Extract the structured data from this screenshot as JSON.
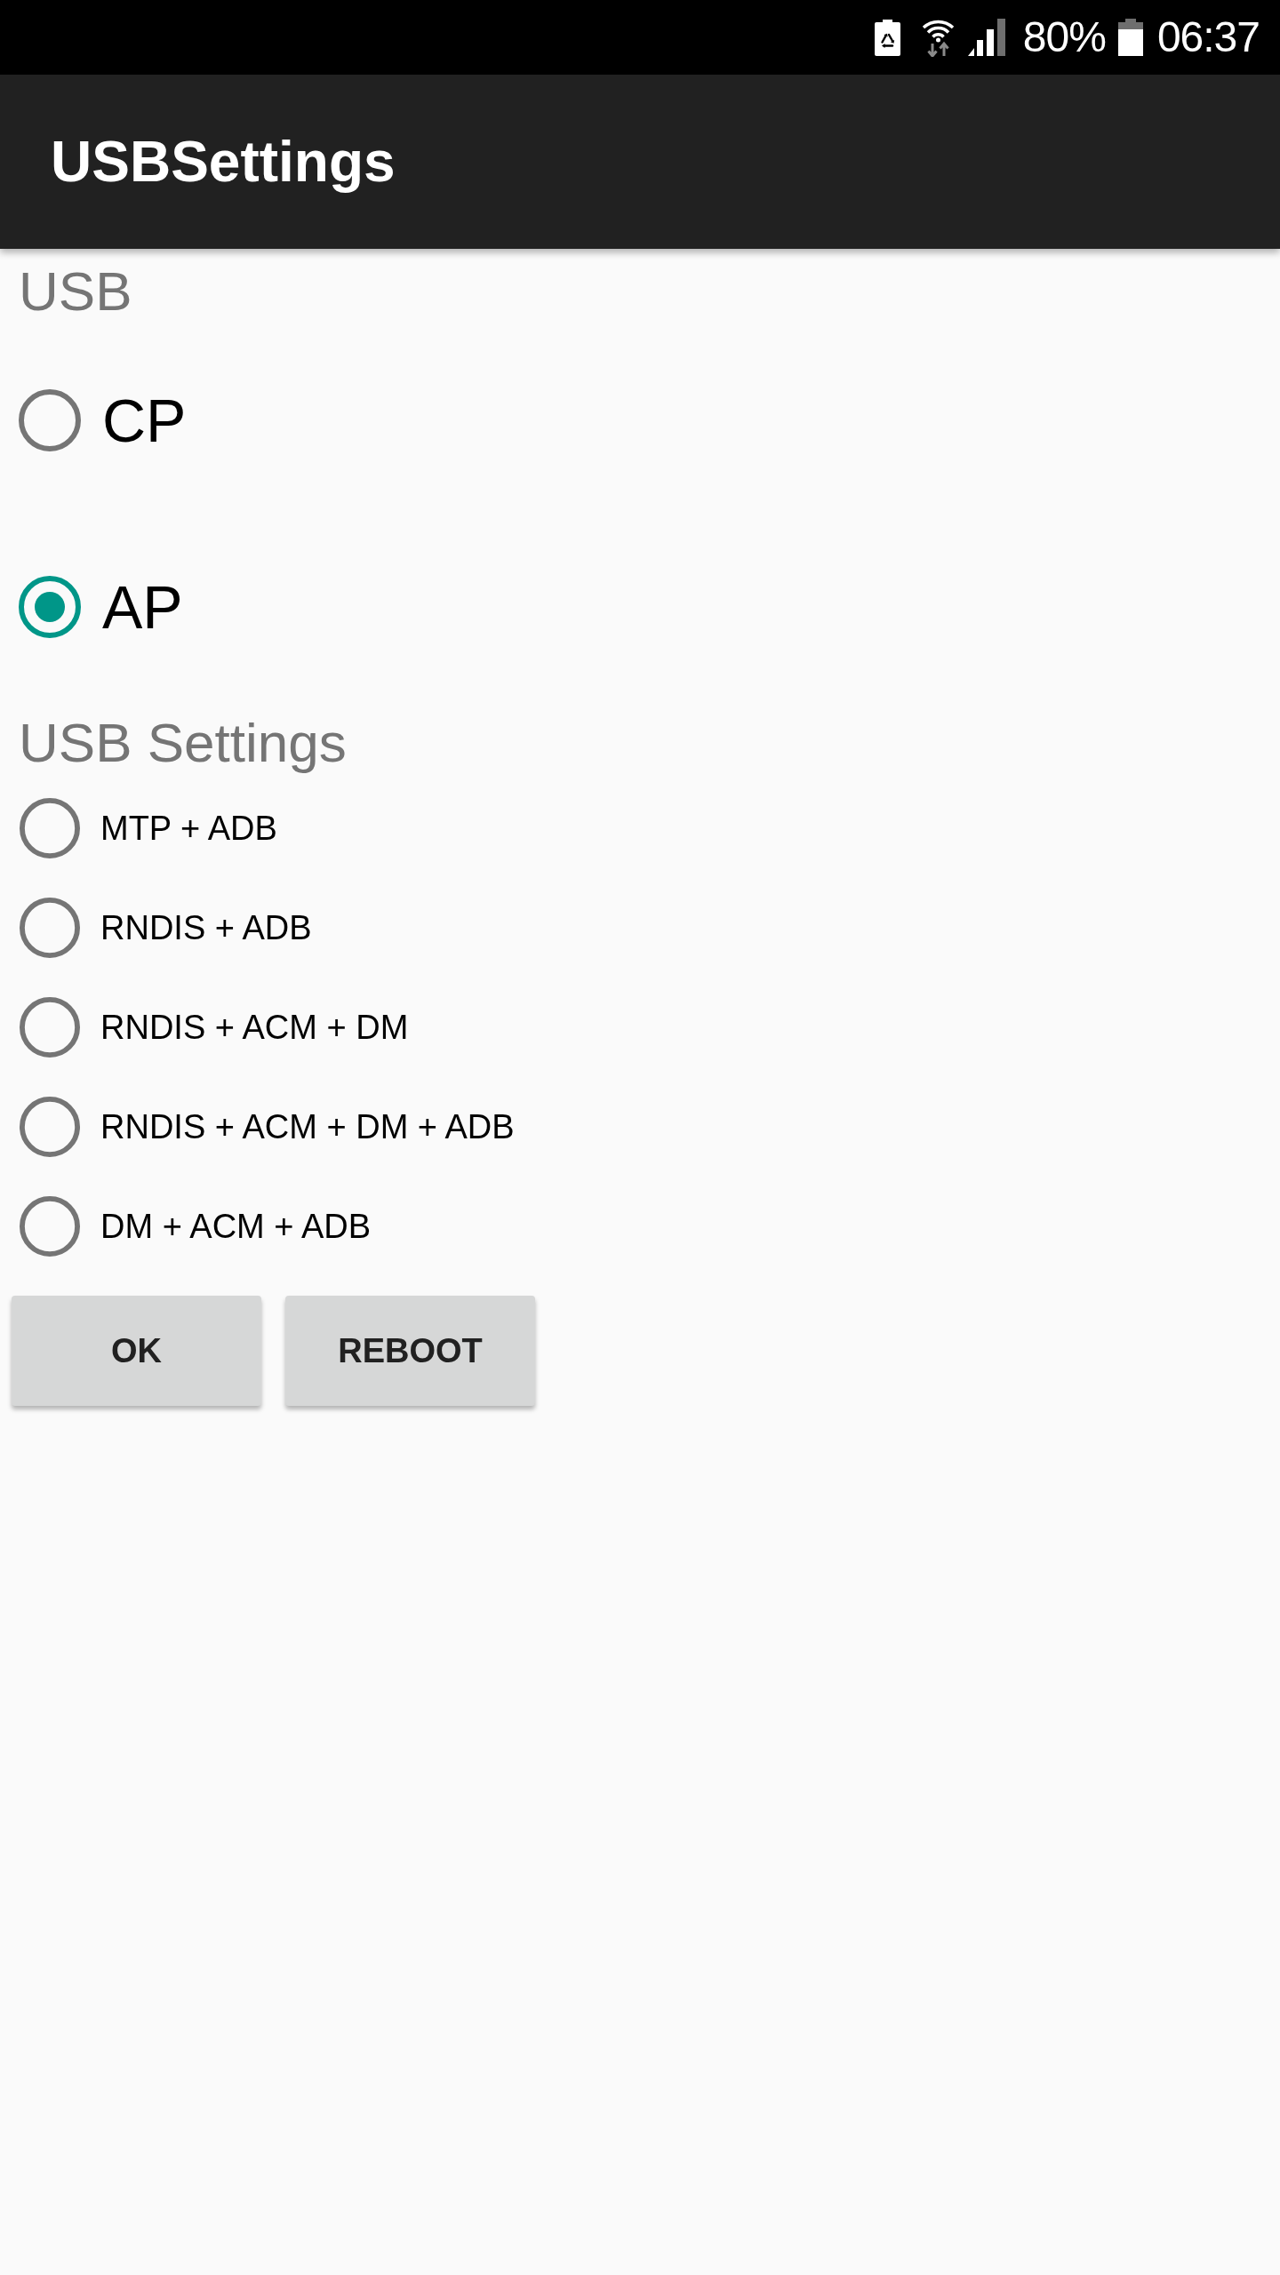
{
  "status_bar": {
    "battery_percent": "80%",
    "time": "06:37"
  },
  "app_bar": {
    "title": "USBSettings"
  },
  "sections": [
    {
      "header": "USB",
      "kind": "large",
      "options": [
        {
          "label": "CP",
          "selected": false
        },
        {
          "label": "AP",
          "selected": true
        }
      ]
    },
    {
      "header": "USB Settings",
      "kind": "compact",
      "options": [
        {
          "label": "MTP + ADB",
          "selected": false
        },
        {
          "label": "RNDIS + ADB",
          "selected": false
        },
        {
          "label": "RNDIS + ACM + DM",
          "selected": false
        },
        {
          "label": "RNDIS + ACM + DM + ADB",
          "selected": false
        },
        {
          "label": "DM + ACM + ADB",
          "selected": false
        }
      ]
    }
  ],
  "buttons": [
    {
      "label": "OK"
    },
    {
      "label": "REBOOT"
    }
  ]
}
